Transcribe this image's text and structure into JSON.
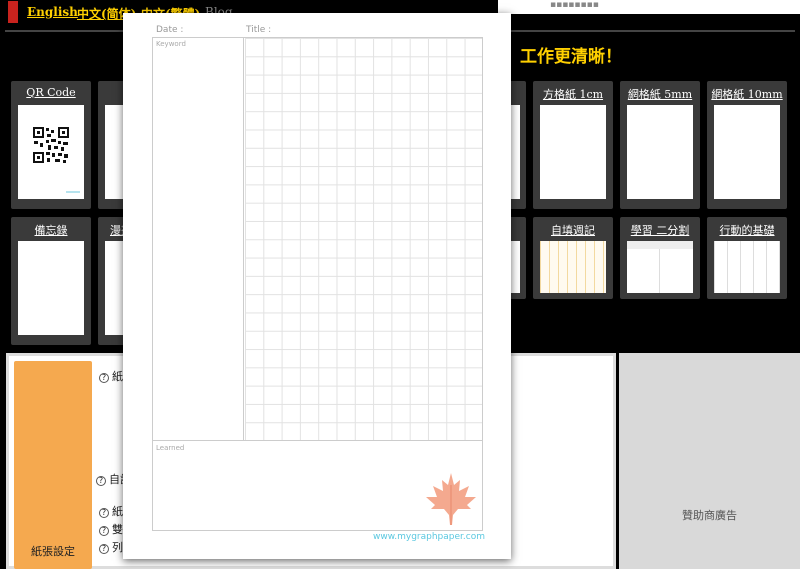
{
  "nav": {
    "english": "English",
    "simplified": "中文(简体)",
    "traditional": "中文(繁體)",
    "blog": "Blog"
  },
  "slogan": "課、工作更清晰！",
  "tiles_row1": [
    {
      "label": "QR Code"
    },
    {
      "label": "方格紙 1cm"
    },
    {
      "label": "網格紙 5mm"
    },
    {
      "label": "網格紙 10mm"
    }
  ],
  "tiles_row2": [
    {
      "label": "備忘錄"
    },
    {
      "label": "漫畫"
    },
    {
      "label": "自填週記"
    },
    {
      "label": "學習 二分割"
    },
    {
      "label": "行動的基礎"
    }
  ],
  "settings": {
    "panel_label": "紙張設定",
    "opt1": "紙",
    "opt2": "自訂",
    "opt3": "紙",
    "opt4": "雙",
    "opt5": "列"
  },
  "sponsor": "贊助商廣告",
  "preview": {
    "date_label": "Date :",
    "title_label": "Title :",
    "keyword_label": "Keyword",
    "learned_label": "Learned",
    "url": "www.mygraphpaper.com"
  },
  "colors": {
    "accent_yellow": "#ffd000",
    "settings_orange": "#f5a94f",
    "brand_red": "#c8231e",
    "leaf": "#f08c6a"
  }
}
